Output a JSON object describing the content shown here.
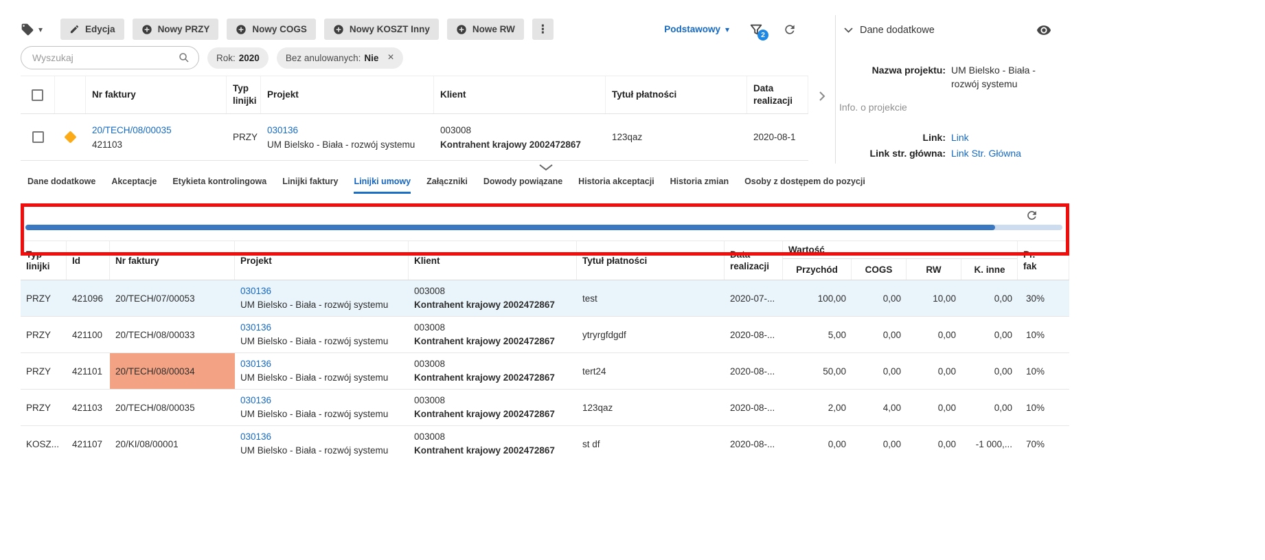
{
  "colors": {
    "accent_blue": "#1669c1",
    "annotation_red": "#f20d0d",
    "scrollbar_blue": "#3b78c2",
    "selected_row_bg": "#e9f4fb",
    "highlight_cell_bg": "#f3a383",
    "diamond_orange": "#fbab18",
    "filter_badge_bg": "#1e88e5",
    "active_tab_blue": "#1565c0"
  },
  "icons": {
    "kebab": "⋮",
    "caret_down": "▾",
    "close": "×"
  },
  "toolbar": {
    "buttons": [
      {
        "label": "Edycja",
        "icon": "pencil-icon"
      },
      {
        "label": "Nowy PRZY",
        "icon": "plus-circle-icon"
      },
      {
        "label": "Nowy COGS",
        "icon": "plus-circle-icon"
      },
      {
        "label": "Nowy KOSZT Inny",
        "icon": "plus-circle-icon"
      },
      {
        "label": "Nowe RW",
        "icon": "plus-circle-icon"
      }
    ],
    "view_selector": "Podstawowy",
    "filter_badge": "2"
  },
  "filters": {
    "search_placeholder": "Wyszukaj",
    "chips": [
      {
        "label": "Rok:",
        "value": "2020"
      },
      {
        "label": "Bez anulowanych:",
        "value": "Nie"
      }
    ]
  },
  "top_table": {
    "headers": [
      "Nr faktury",
      "Typ linijki",
      "Projekt",
      "Klient",
      "Tytuł płatności",
      "Data realizacji"
    ],
    "row": {
      "nr_faktury": "20/TECH/08/00035",
      "id": "421103",
      "typ_linijki": "PRZY",
      "projekt_code": "030136",
      "projekt_name": "UM Bielsko - Biała - rozwój systemu",
      "klient_code": "003008",
      "klient_name": "Kontrahent krajowy 2002472867",
      "tytul_platnosci": "123qaz",
      "data_realizacji": "2020-08-1"
    }
  },
  "detail_panel": {
    "title": "Dane dodatkowe",
    "nazwa_projektu_label": "Nazwa projektu:",
    "nazwa_projektu_value": "UM Bielsko - Biała - rozwój systemu",
    "section_label": "Info. o projekcie",
    "link_label": "Link:",
    "link_value": "Link",
    "link_glowna_label": "Link str. główna:",
    "link_glowna_value": "Link Str. Główna"
  },
  "tabs": {
    "active": "Linijki umowy",
    "items": [
      "Dane dodatkowe",
      "Akceptacje",
      "Etykieta kontrolingowa",
      "Linijki faktury",
      "Linijki umowy",
      "Załączniki",
      "Dowody powiązane",
      "Historia akceptacji",
      "Historia zmian",
      "Osoby z dostępem do pozycji"
    ]
  },
  "bottom_table": {
    "headers": {
      "typ": "Typ linijki",
      "id": "Id",
      "nr": "Nr faktury",
      "projekt": "Projekt",
      "klient": "Klient",
      "tytul": "Tytuł płatności",
      "data": "Data realizacji",
      "wartosc": "Wartość",
      "sub": [
        "Przychód",
        "COGS",
        "RW",
        "K. inne"
      ],
      "pr_line1": "Pr.",
      "pr_line2": "fak"
    },
    "rows": [
      {
        "typ": "PRZY",
        "id": "421096",
        "nr": "20/TECH/07/00053",
        "projekt_code": "030136",
        "projekt_name": "UM Bielsko - Biała - rozwój systemu",
        "klient_code": "003008",
        "klient_name": "Kontrahent krajowy 2002472867",
        "tytul": "test",
        "data": "2020-07-...",
        "przychod": "100,00",
        "cogs": "0,00",
        "rw": "10,00",
        "k_inne": "0,00",
        "pr_fak": "30%",
        "selected": true
      },
      {
        "typ": "PRZY",
        "id": "421100",
        "nr": "20/TECH/08/00033",
        "projekt_code": "030136",
        "projekt_name": "UM Bielsko - Biała - rozwój systemu",
        "klient_code": "003008",
        "klient_name": "Kontrahent krajowy 2002472867",
        "tytul": "ytryrgfdgdf",
        "data": "2020-08-...",
        "przychod": "5,00",
        "cogs": "0,00",
        "rw": "0,00",
        "k_inne": "0,00",
        "pr_fak": "10%"
      },
      {
        "typ": "PRZY",
        "id": "421101",
        "nr": "20/TECH/08/00034",
        "projekt_code": "030136",
        "projekt_name": "UM Bielsko - Biała - rozwój systemu",
        "klient_code": "003008",
        "klient_name": "Kontrahent krajowy 2002472867",
        "tytul": "tert24",
        "data": "2020-08-...",
        "przychod": "50,00",
        "cogs": "0,00",
        "rw": "0,00",
        "k_inne": "0,00",
        "pr_fak": "10%",
        "nr_highlighted": true
      },
      {
        "typ": "PRZY",
        "id": "421103",
        "nr": "20/TECH/08/00035",
        "projekt_code": "030136",
        "projekt_name": "UM Bielsko - Biała - rozwój systemu",
        "klient_code": "003008",
        "klient_name": "Kontrahent krajowy 2002472867",
        "tytul": "123qaz",
        "data": "2020-08-...",
        "przychod": "2,00",
        "cogs": "4,00",
        "rw": "0,00",
        "k_inne": "0,00",
        "pr_fak": "10%"
      },
      {
        "typ": "KOSZ...",
        "id": "421107",
        "nr": "20/KI/08/00001",
        "projekt_code": "030136",
        "projekt_name": "UM Bielsko - Biała - rozwój systemu",
        "klient_code": "003008",
        "klient_name": "Kontrahent krajowy 2002472867",
        "tytul": "st df",
        "data": "2020-08-...",
        "przychod": "0,00",
        "cogs": "0,00",
        "rw": "0,00",
        "k_inne": "-1 000,...",
        "pr_fak": "70%"
      }
    ]
  }
}
